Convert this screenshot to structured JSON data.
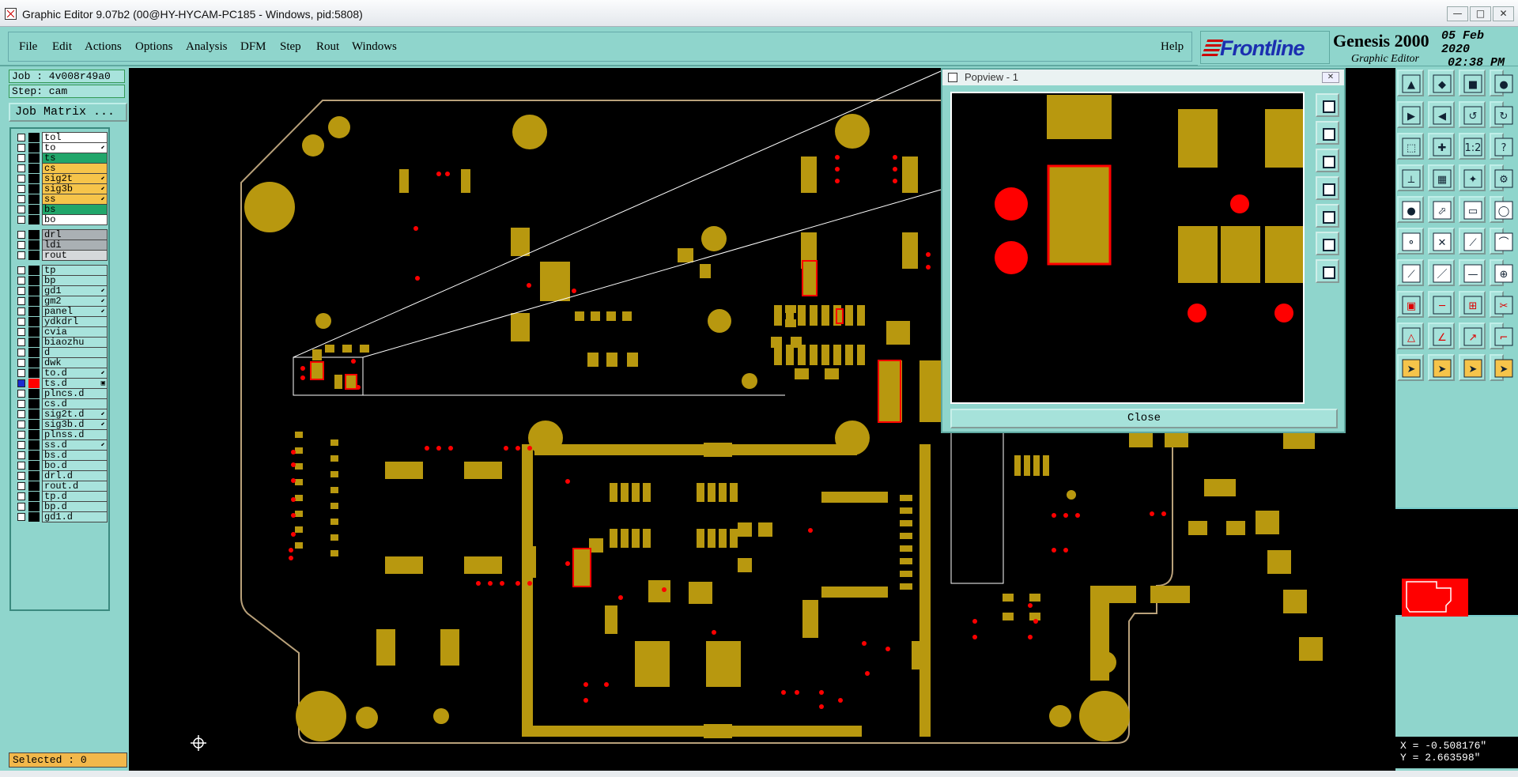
{
  "window": {
    "title": "Graphic Editor 9.07b2 (00@HY-HYCAM-PC185 - Windows, pid:5808)",
    "min": "—",
    "max": "□",
    "close": "✕"
  },
  "menu": [
    {
      "label": "File"
    },
    {
      "label": "Edit"
    },
    {
      "label": "Actions"
    },
    {
      "label": "Options"
    },
    {
      "label": "Analysis"
    },
    {
      "label": "DFM"
    },
    {
      "label": "Step"
    },
    {
      "label": "Rout"
    },
    {
      "label": "Windows"
    }
  ],
  "help": "Help",
  "brand": {
    "logo": "Frontline",
    "product": "Genesis 2000",
    "subtitle": "Graphic Editor",
    "date": "05 Feb 2020",
    "time": "02:38 PM"
  },
  "job": {
    "job": "Job : 4v008r49a0",
    "step": "Step: cam",
    "matrix_button": "Job Matrix ..."
  },
  "layers": [
    {
      "name": "tol",
      "bg": "#ffffff",
      "mk": ""
    },
    {
      "name": "to",
      "bg": "#ffffff",
      "mk": "⬋"
    },
    {
      "name": "ts",
      "bg": "#21a66a",
      "mk": ""
    },
    {
      "name": "cs",
      "bg": "#f6c44a",
      "mk": ""
    },
    {
      "name": "sig2t",
      "bg": "#f6c44a",
      "mk": "⬋"
    },
    {
      "name": "sig3b",
      "bg": "#f6c44a",
      "mk": "⬋"
    },
    {
      "name": "ss",
      "bg": "#f6c44a",
      "mk": "⬋"
    },
    {
      "name": "bs",
      "bg": "#21a66a",
      "mk": ""
    },
    {
      "name": "bo",
      "bg": "#ffffff",
      "mk": ""
    },
    {
      "name": "drl",
      "bg": "#aab0b4",
      "mk": "",
      "gap": true
    },
    {
      "name": "ldi",
      "bg": "#aab0b4",
      "mk": ""
    },
    {
      "name": "rout",
      "bg": "#d5d8da",
      "mk": ""
    },
    {
      "name": "tp",
      "bg": "#a8e3dc",
      "mk": "",
      "gap": true
    },
    {
      "name": "bp",
      "bg": "#a8e3dc",
      "mk": ""
    },
    {
      "name": "gd1",
      "bg": "#a8e3dc",
      "mk": "⬋"
    },
    {
      "name": "gm2",
      "bg": "#a8e3dc",
      "mk": "⬋"
    },
    {
      "name": "panel",
      "bg": "#a8e3dc",
      "mk": "⬋"
    },
    {
      "name": "ydkdrl",
      "bg": "#a8e3dc",
      "mk": ""
    },
    {
      "name": "cvia",
      "bg": "#a8e3dc",
      "mk": ""
    },
    {
      "name": "biaozhu",
      "bg": "#a8e3dc",
      "mk": ""
    },
    {
      "name": "d",
      "bg": "#a8e3dc",
      "mk": ""
    },
    {
      "name": "dwk",
      "bg": "#a8e3dc",
      "mk": ""
    },
    {
      "name": "to.d",
      "bg": "#a8e3dc",
      "mk": "⬋"
    },
    {
      "name": "ts.d",
      "bg": "#a8e3dc",
      "mk": "▣",
      "active": true
    },
    {
      "name": "plncs.d",
      "bg": "#a8e3dc",
      "mk": ""
    },
    {
      "name": "cs.d",
      "bg": "#a8e3dc",
      "mk": ""
    },
    {
      "name": "sig2t.d",
      "bg": "#a8e3dc",
      "mk": "⬋"
    },
    {
      "name": "sig3b.d",
      "bg": "#a8e3dc",
      "mk": "⬋"
    },
    {
      "name": "plnss.d",
      "bg": "#a8e3dc",
      "mk": ""
    },
    {
      "name": "ss.d",
      "bg": "#a8e3dc",
      "mk": "⬋"
    },
    {
      "name": "bs.d",
      "bg": "#a8e3dc",
      "mk": ""
    },
    {
      "name": "bo.d",
      "bg": "#a8e3dc",
      "mk": ""
    },
    {
      "name": "drl.d",
      "bg": "#a8e3dc",
      "mk": ""
    },
    {
      "name": "rout.d",
      "bg": "#a8e3dc",
      "mk": ""
    },
    {
      "name": "tp.d",
      "bg": "#a8e3dc",
      "mk": ""
    },
    {
      "name": "bp.d",
      "bg": "#a8e3dc",
      "mk": ""
    },
    {
      "name": "gd1.d",
      "bg": "#a8e3dc",
      "mk": ""
    }
  ],
  "selected": "Selected : 0",
  "popview": {
    "title": "Popview - 1",
    "close": "Close"
  },
  "coords": {
    "x": "X = -0.508176\"",
    "y": "Y = 2.663598\""
  },
  "colors": {
    "copper": "#b8980f",
    "highlight": "#ff0000",
    "board_outline": "#b9a17a",
    "panel_bg": "#8fd5cc"
  }
}
